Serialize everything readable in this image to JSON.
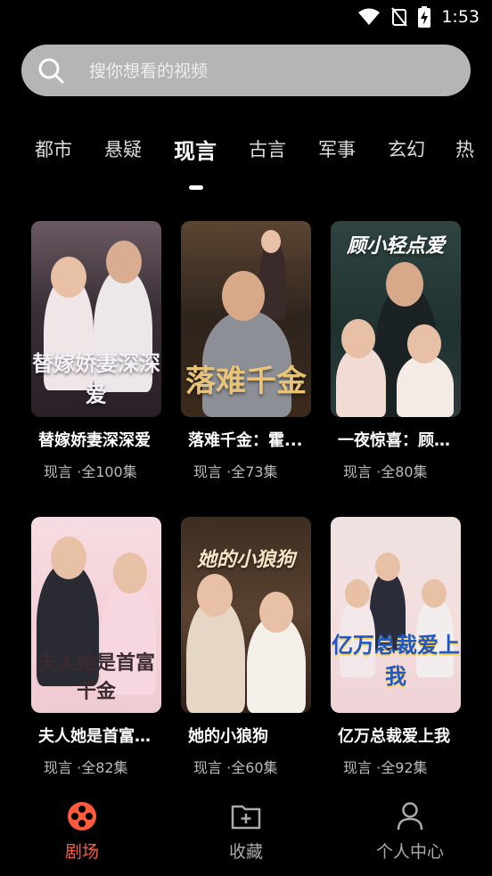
{
  "status": {
    "time": "1:53"
  },
  "search": {
    "placeholder": "搜你想看的视频"
  },
  "categories": [
    "都市",
    "悬疑",
    "现言",
    "古言",
    "军事",
    "玄幻",
    "热"
  ],
  "active_category": "现言",
  "cards": [
    {
      "title": "替嫁娇妻深深爱",
      "poster_text": "替嫁娇妻深深爱",
      "genre": "现言",
      "episodes": "·全100集"
    },
    {
      "title": "落难千金：霍...",
      "poster_text": "落难千金",
      "genre": "现言",
      "episodes": "·全73集"
    },
    {
      "title": "一夜惊喜：顾小轻点爱",
      "poster_text": "顾小轻点爱",
      "genre": "现言",
      "episodes": "·全80集"
    },
    {
      "title": "夫人她是首富千金",
      "poster_text": "夫人她是首富千金",
      "genre": "现言",
      "episodes": "·全82集"
    },
    {
      "title": "她的小狼狗",
      "poster_text": "她的小狼狗",
      "genre": "现言",
      "episodes": "·全60集"
    },
    {
      "title": "亿万总裁爱上我",
      "poster_text": "亿万总裁爱上我",
      "genre": "现言",
      "episodes": "·全92集"
    }
  ],
  "nav": [
    {
      "label": "剧场",
      "icon": "theater-reel-icon",
      "active": true
    },
    {
      "label": "收藏",
      "icon": "folder-add-icon",
      "active": false
    },
    {
      "label": "个人中心",
      "icon": "person-icon",
      "active": false
    }
  ],
  "colors": {
    "accent": "#ff5a3c",
    "background": "#000000",
    "search_bg": "#b5b5b5"
  }
}
